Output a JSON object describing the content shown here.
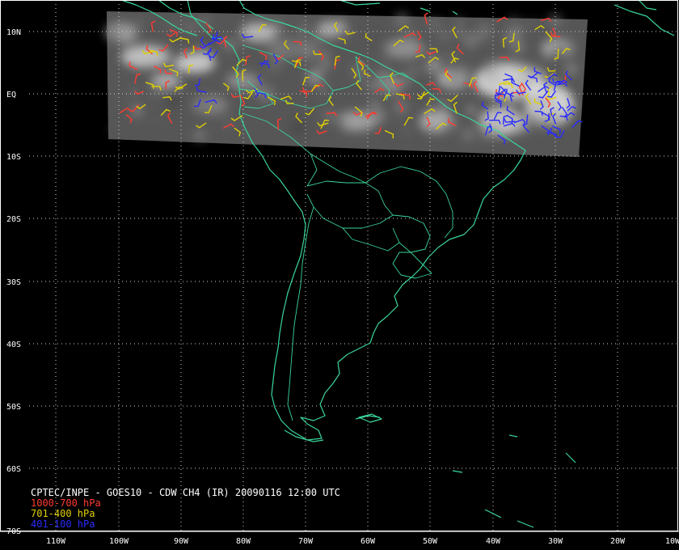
{
  "caption": {
    "title": "CPTEC/INPE - GOES10 - CDW CH4 (IR) 20090116 12:00 UTC"
  },
  "legend": [
    {
      "label": "1000-700 hPa",
      "color": "#ff3b30"
    },
    {
      "label": "701-400 hPa",
      "color": "#e0d000"
    },
    {
      "label": "401-100 hPa",
      "color": "#2a2aff"
    }
  ],
  "latitude_labels": [
    "10N",
    "EQ",
    "10S",
    "20S",
    "30S",
    "40S",
    "50S",
    "60S",
    "70S"
  ],
  "longitude_labels": [
    "110W",
    "100W",
    "90W",
    "80W",
    "70W",
    "60W",
    "50W",
    "40W",
    "30W",
    "20W",
    "10W"
  ],
  "colors": {
    "background": "#000000",
    "coastline": "#3ad69a",
    "grid": "#cfcfcf",
    "frame": "#ffffff",
    "imagery_base": "#5a5a5a"
  },
  "layers": [
    "satellite-ir-imagery",
    "cloud-drift-winds",
    "coastlines",
    "political-borders",
    "lat-lon-grid"
  ]
}
